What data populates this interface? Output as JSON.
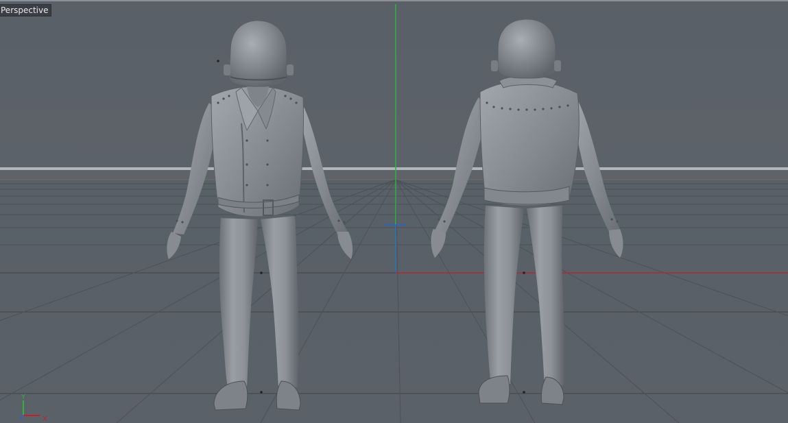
{
  "viewport": {
    "label": "Perspective",
    "background_color": "#5b6168",
    "grid_color": "#4c5258",
    "horizon_color": "#aeb4b9",
    "x_axis_color": "#c2202a",
    "y_axis_color": "#2fb43a",
    "z_axis_color": "#2a5fd6"
  },
  "models": [
    {
      "name": "character-front-view",
      "color": "#8f949a"
    },
    {
      "name": "character-back-view",
      "color": "#8f949a"
    }
  ],
  "axis_gizmo": {
    "y_label": "Y",
    "x_label": "X"
  }
}
